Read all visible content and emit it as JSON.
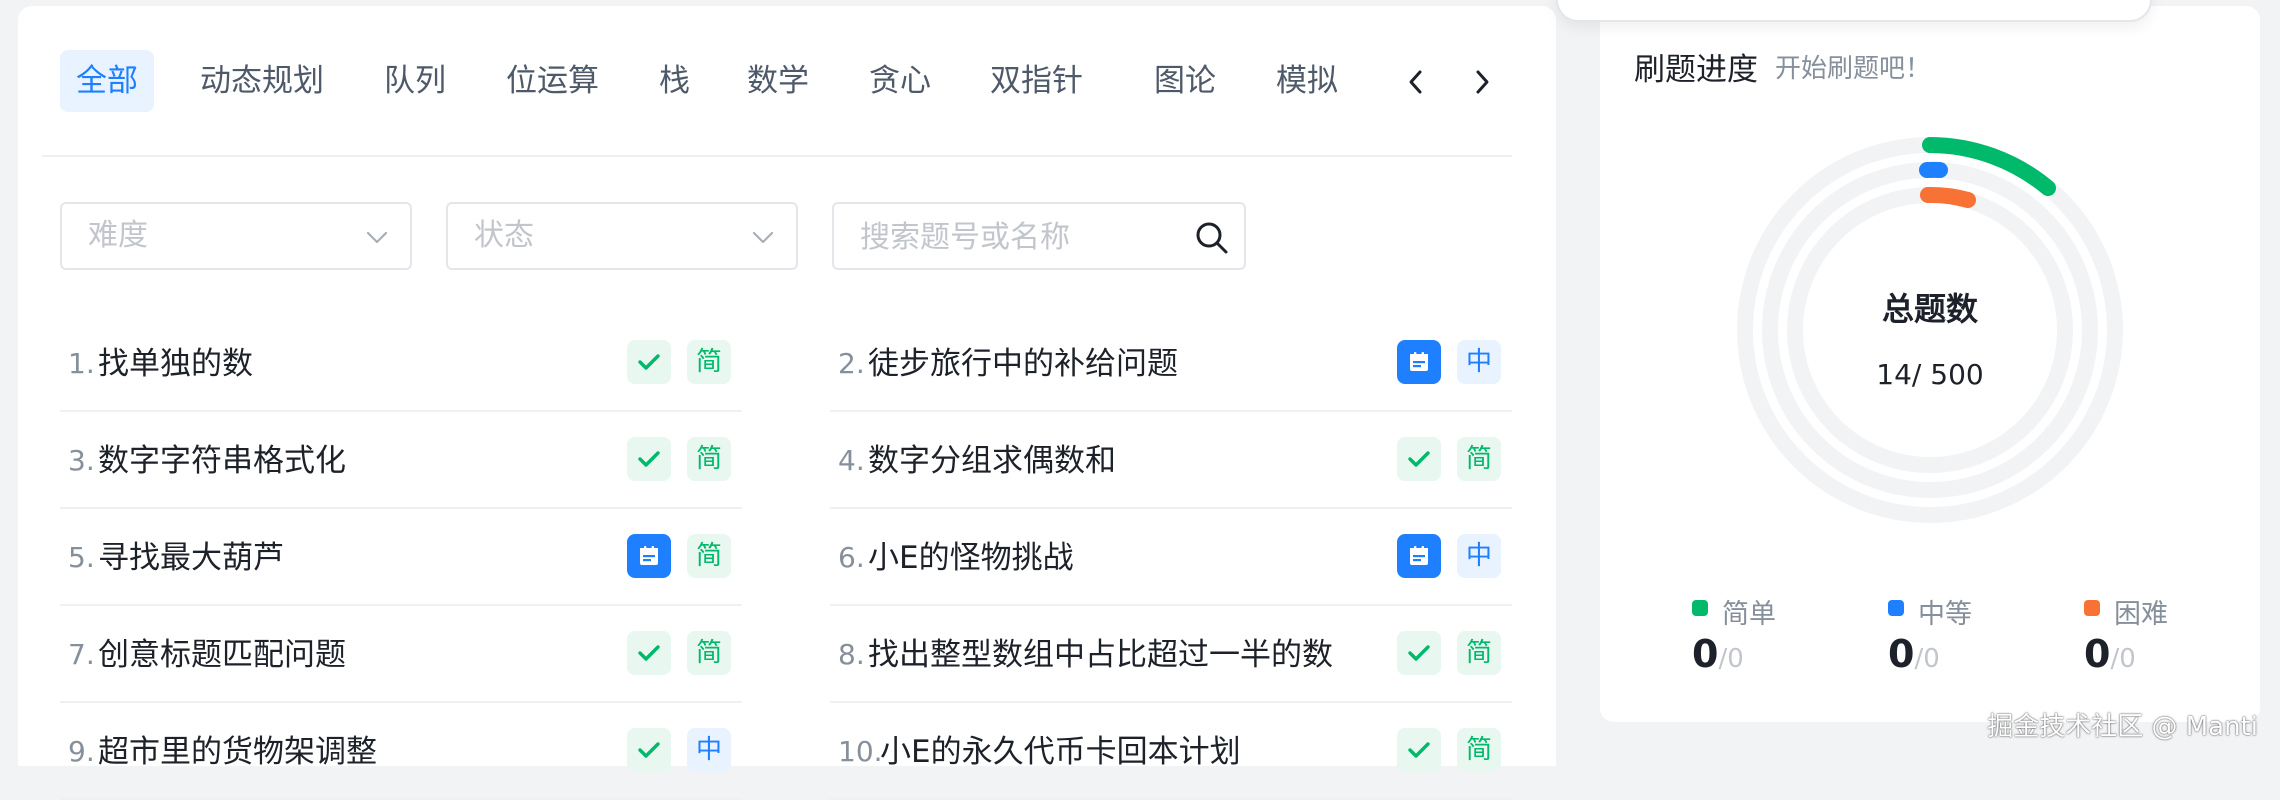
{
  "tabs": {
    "items": [
      "全部",
      "动态规划",
      "队列",
      "位运算",
      "栈",
      "数学",
      "贪心",
      "双指针",
      "图论",
      "模拟"
    ],
    "active_index": 0
  },
  "filters": {
    "difficulty_placeholder": "难度",
    "status_placeholder": "状态",
    "search_placeholder": "搜索题号或名称"
  },
  "problems": [
    {
      "index": "1.",
      "name": "找单独的数",
      "status": "check-icon",
      "difficulty": "简"
    },
    {
      "index": "2.",
      "name": "徒步旅行中的补给问题",
      "status": "calendar-icon",
      "difficulty": "中"
    },
    {
      "index": "3.",
      "name": "数字字符串格式化",
      "status": "check-icon",
      "difficulty": "简"
    },
    {
      "index": "4.",
      "name": "数字分组求偶数和",
      "status": "check-icon",
      "difficulty": "简"
    },
    {
      "index": "5.",
      "name": "寻找最大葫芦",
      "status": "calendar-icon",
      "difficulty": "简"
    },
    {
      "index": "6.",
      "name": "小E的怪物挑战",
      "status": "calendar-icon",
      "difficulty": "中"
    },
    {
      "index": "7.",
      "name": "创意标题匹配问题",
      "status": "check-icon",
      "difficulty": "简"
    },
    {
      "index": "8.",
      "name": "找出整型数组中占比超过一半的数",
      "status": "check-icon",
      "difficulty": "简"
    },
    {
      "index": "9.",
      "name": "超市里的货物架调整",
      "status": "check-icon",
      "difficulty": "中"
    },
    {
      "index": "10.",
      "name": "小E的永久代币卡回本计划",
      "status": "check-icon",
      "difficulty": "简"
    }
  ],
  "progress": {
    "title": "刷题进度",
    "subtitle": "开始刷题吧！",
    "total_label": "总题数",
    "total_value": "14/ 500",
    "stats": [
      {
        "label": "简单",
        "value": "0",
        "total": "/0",
        "color": "#00b96b"
      },
      {
        "label": "中等",
        "value": "0",
        "total": "/0",
        "color": "#1e80ff"
      },
      {
        "label": "困难",
        "value": "0",
        "total": "/0",
        "color": "#f77234"
      }
    ]
  },
  "colors": {
    "accent": "#1e80ff",
    "easy": "#00b96b",
    "medium": "#1e80ff",
    "hard": "#f77234",
    "ring_track": "#f2f3f5"
  },
  "watermark": "掘金技术社区 @ Manti"
}
